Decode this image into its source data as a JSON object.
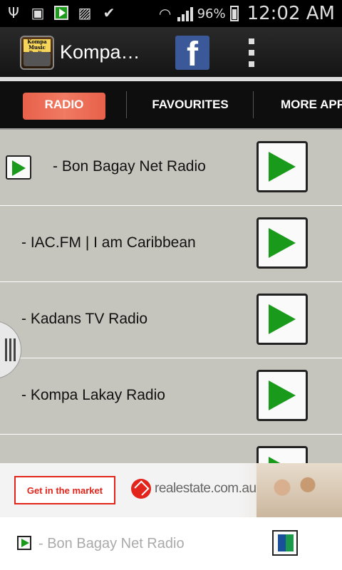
{
  "status_bar": {
    "battery": "96%",
    "time": "12:02 AM"
  },
  "app_bar": {
    "title": "Kompa…",
    "logo_text": "Kompa Music Radio",
    "facebook_label": "f"
  },
  "tabs": [
    {
      "label": "RADIO",
      "active": true
    },
    {
      "label": "FAVOURITES",
      "active": false
    },
    {
      "label": "MORE APP",
      "active": false
    }
  ],
  "stations": [
    {
      "name": "- Bon Bagay Net Radio",
      "playing": true
    },
    {
      "name": "- IAC.FM | I am Caribbean",
      "playing": false
    },
    {
      "name": "- Kadans TV Radio",
      "playing": false
    },
    {
      "name": "- Kompa Lakay Radio",
      "playing": false
    },
    {
      "name": "",
      "playing": false
    }
  ],
  "ad": {
    "cta": "Get in the market",
    "brand": "realestate.com.au"
  },
  "now_playing": {
    "title": "- Bon Bagay Net Radio"
  },
  "colors": {
    "accent_tab": "#e8604a",
    "play_green": "#1a9a1a",
    "facebook_blue": "#3b5998",
    "ad_red": "#e2241a"
  }
}
